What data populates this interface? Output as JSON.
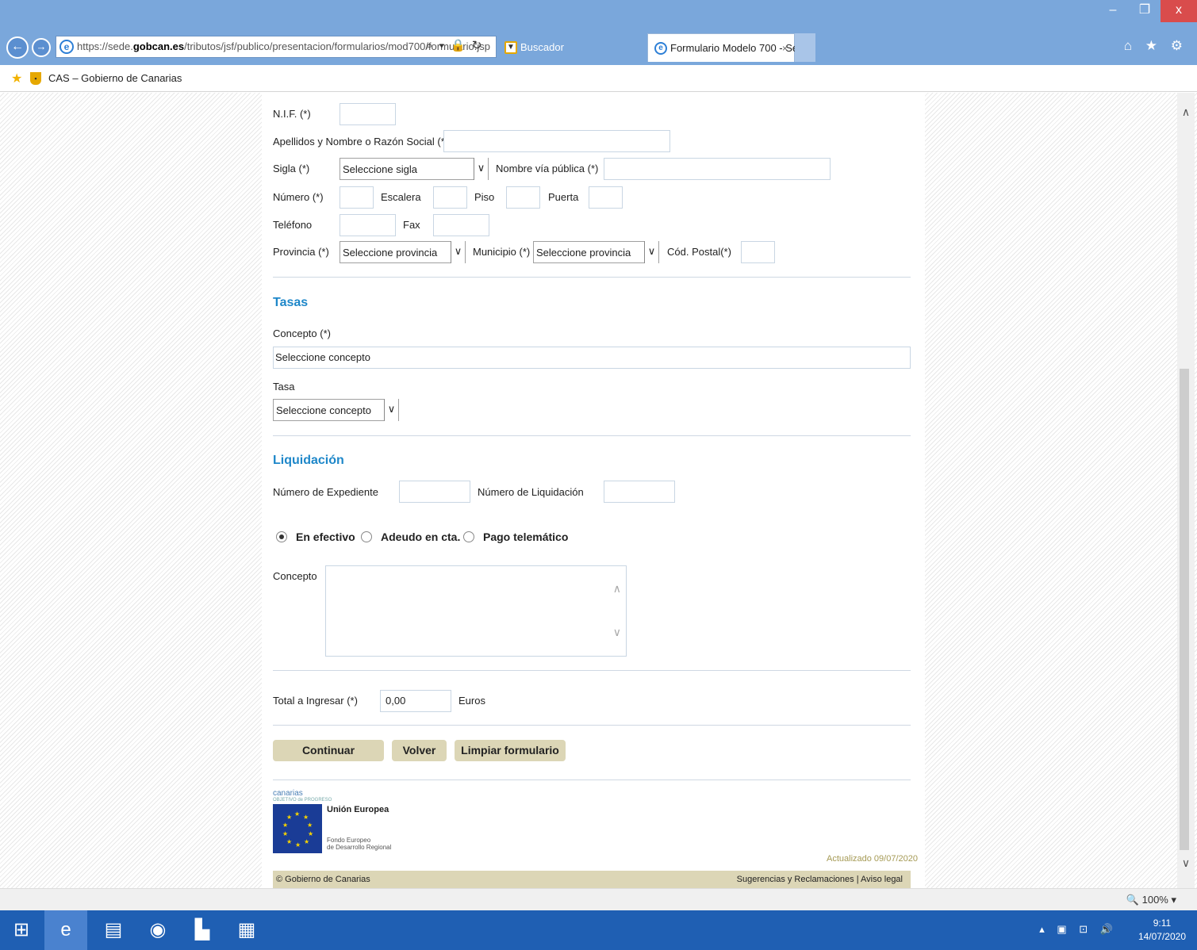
{
  "browser": {
    "url_prefix": "https://sede.",
    "url_domain": "gobcan.es",
    "url_path": "/tributos/jsf/publico/presentacion/formularios/mod700/formulario.jsp",
    "address_icons": "⌕ ▾ 🔒 ↻",
    "tabs": [
      {
        "label": "Buscador"
      },
      {
        "label": "Formulario Modelo 700 - Se..."
      }
    ],
    "tab_close": "×",
    "favorite_label": "CAS – Gobierno de Canarias",
    "window_min": "–",
    "window_max": "❐",
    "window_close": "x",
    "right_icons": "⌂ ★ ⚙",
    "back": "←",
    "forward": "→"
  },
  "form": {
    "nif_label": "N.I.F. (*)",
    "name_label": "Apellidos y Nombre o Razón Social (*)",
    "sigla_label": "Sigla (*)",
    "sigla_value": "Seleccione sigla",
    "via_label": "Nombre vía pública (*)",
    "numero_label": "Número (*)",
    "escalera_label": "Escalera",
    "piso_label": "Piso",
    "puerta_label": "Puerta",
    "telefono_label": "Teléfono",
    "fax_label": "Fax",
    "provincia_label": "Provincia (*)",
    "provincia_value": "Seleccione provincia",
    "municipio_label": "Municipio (*)",
    "municipio_value": "Seleccione provincia",
    "cp_label": "Cód. Postal(*)"
  },
  "tasas": {
    "title": "Tasas",
    "concepto_label": "Concepto (*)",
    "concepto_value": "Seleccione concepto",
    "tasa_label": "Tasa",
    "tasa_value": "Seleccione concepto"
  },
  "liquidacion": {
    "title": "Liquidación",
    "expediente_label": "Número de Expediente",
    "liquidacion_label": "Número de Liquidación",
    "payment_options": [
      {
        "label": "En efectivo",
        "selected": true
      },
      {
        "label": "Adeudo en cta.",
        "selected": false
      },
      {
        "label": "Pago telemático",
        "selected": false
      }
    ],
    "concepto_label": "Concepto"
  },
  "total": {
    "label": "Total a Ingresar (*)",
    "value": "0,00",
    "unit": "Euros"
  },
  "buttons": {
    "continuar": "Continuar",
    "volver": "Volver",
    "limpiar": "Limpiar formulario"
  },
  "footer": {
    "canarias": "canarias",
    "canarias_sub": "OBJETIVO de PROGRESO",
    "eu_title": "Unión Europea",
    "eu_sub_1": "Fondo Europeo",
    "eu_sub_2": "de Desarrollo Regional",
    "updated": "Actualizado  09/07/2020",
    "copyright": "© Gobierno de Canarias",
    "links": "Sugerencias y Reclamaciones  | Aviso legal"
  },
  "status": {
    "zoom": "🔍 100%  ▾"
  },
  "taskbar": {
    "time": "9:11",
    "date": "14/07/2020",
    "tray": "▴ ▣ ⊡ 🔊"
  },
  "colors": {
    "accent": "#1e87c9",
    "button_bg": "#dcd6b6",
    "chrome": "#7aa7db",
    "taskbar": "#1f5fb3"
  }
}
